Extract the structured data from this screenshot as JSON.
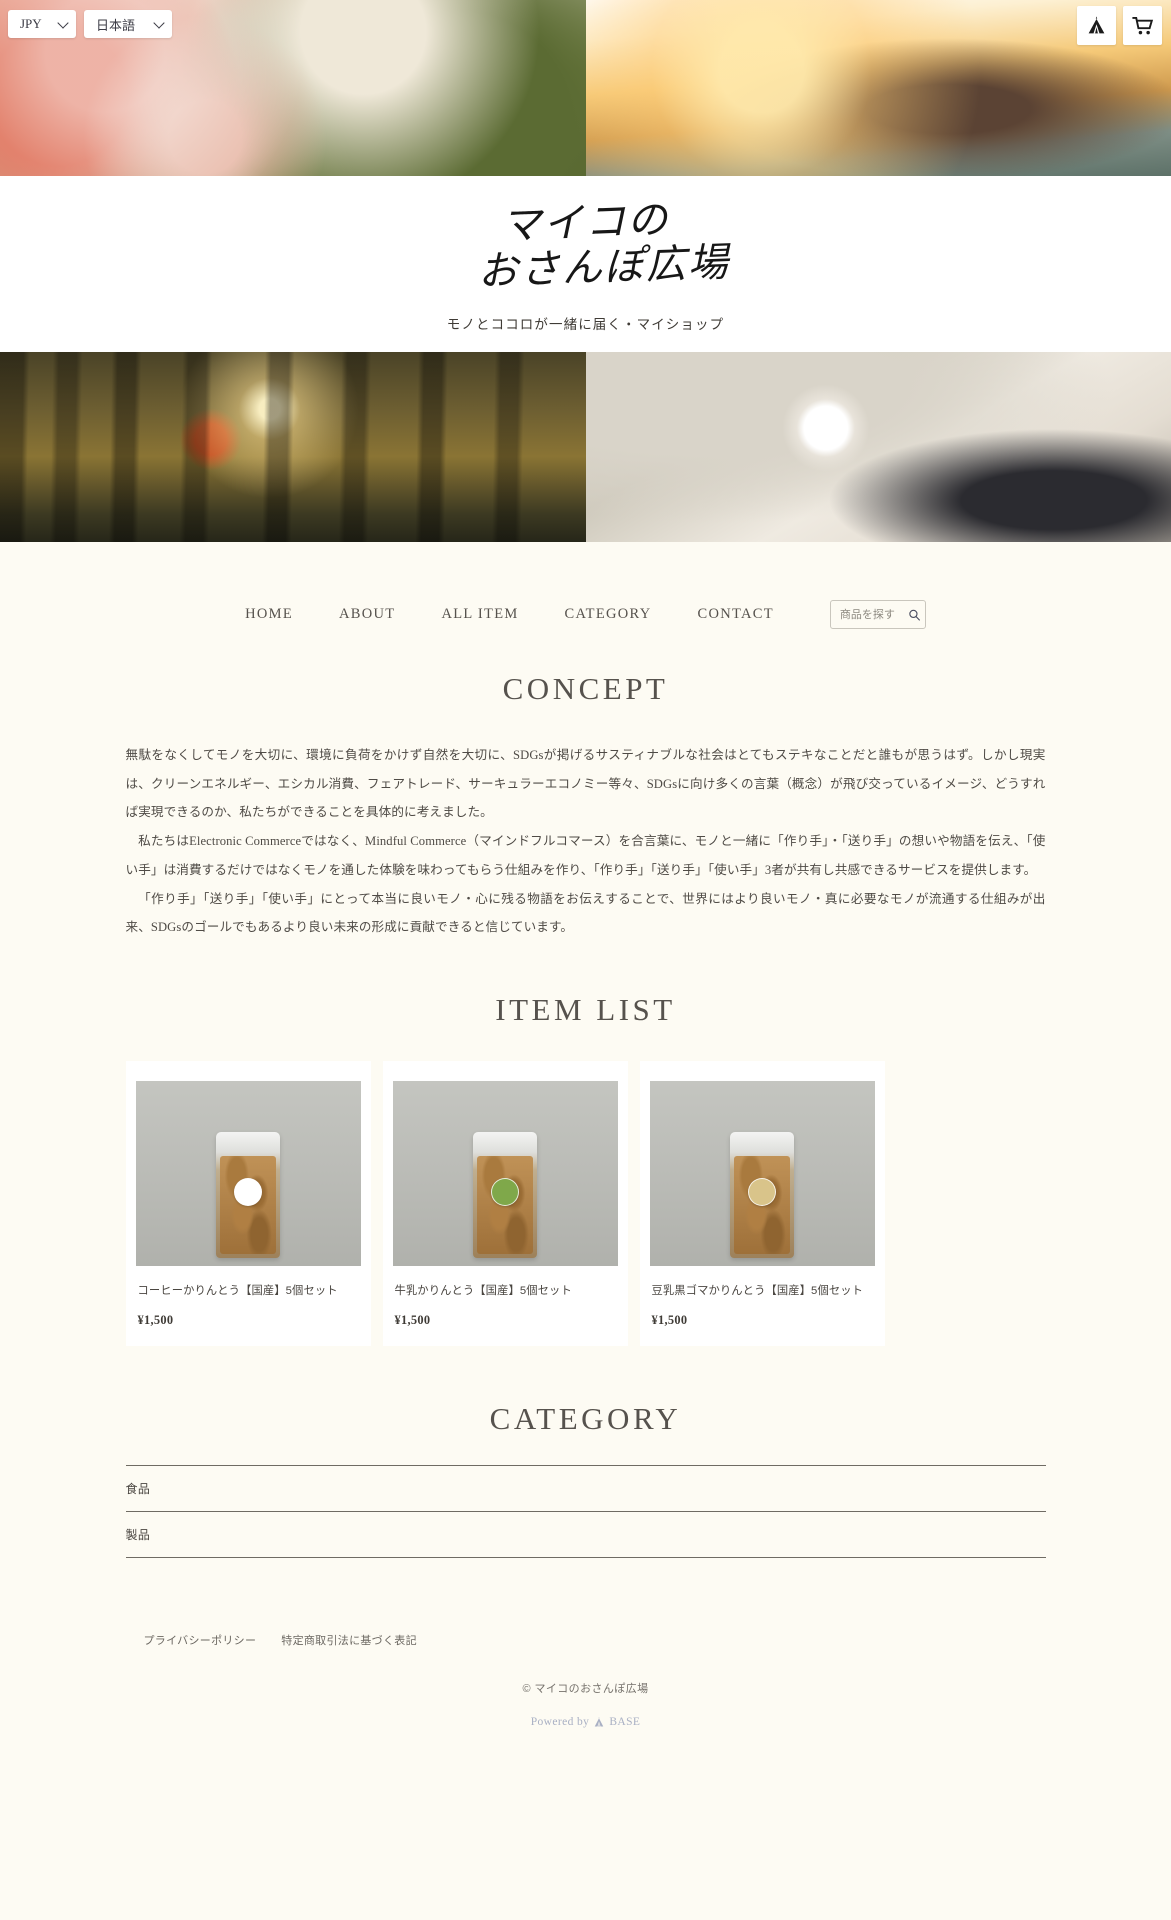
{
  "topbar": {
    "currency": {
      "value": "JPY",
      "icon": "chevron-down-icon"
    },
    "language": {
      "value": "日本語",
      "icon": "chevron-down-icon"
    },
    "shop_icon": "base-tent-icon",
    "cart_icon": "shopping-cart-icon"
  },
  "header": {
    "logo_line_1": "マイコの",
    "logo_line_2": "おさんぽ広場",
    "tagline": "モノとココロが一緒に届く・マイショップ"
  },
  "nav": {
    "items": [
      {
        "label": "HOME"
      },
      {
        "label": "ABOUT"
      },
      {
        "label": "ALL ITEM"
      },
      {
        "label": "CATEGORY"
      },
      {
        "label": "CONTACT"
      }
    ],
    "search": {
      "placeholder": "商品を探す",
      "value": "",
      "icon": "search-icon"
    }
  },
  "concept": {
    "title": "CONCEPT",
    "paragraphs": [
      "無駄をなくしてモノを大切に、環境に負荷をかけず自然を大切に、SDGsが掲げるサスティナブルな社会はとてもステキなことだと誰もが思うはず。しかし現実は、クリーンエネルギー、エシカル消費、フェアトレード、サーキュラーエコノミー等々、SDGsに向け多くの言葉（概念）が飛び交っているイメージ、どうすれば実現できるのか、私たちができることを具体的に考えました。",
      "私たちはElectronic Commerceではなく、Mindful Commerce（マインドフルコマース）を合言葉に、モノと一緒に「作り手」・「送り手」の想いや物語を伝え、「使い手」は消費するだけではなくモノを通した体験を味わってもらう仕組みを作り、「作り手」「送り手」「使い手」3者が共有し共感できるサービスを提供します。",
      "「作り手」「送り手」「使い手」にとって本当に良いモノ・心に残る物語をお伝えすることで、世界にはより良いモノ・真に必要なモノが流通する仕組みが出来、SDGsのゴールでもあるより良い未来の形成に貢献できると信じています。"
    ]
  },
  "item_list": {
    "title": "ITEM LIST",
    "items": [
      {
        "name": "コーヒーかりんとう【国産】5個セット",
        "price": "¥1,500",
        "label_color": "#ffffff"
      },
      {
        "name": "牛乳かりんとう【国産】5個セット",
        "price": "¥1,500",
        "label_color": "#7fa84a"
      },
      {
        "name": "豆乳黒ゴマかりんとう【国産】5個セット",
        "price": "¥1,500",
        "label_color": "#d9c48a"
      }
    ]
  },
  "category": {
    "title": "CATEGORY",
    "items": [
      {
        "label": "食品"
      },
      {
        "label": "製品"
      }
    ]
  },
  "footer": {
    "links": [
      {
        "label": "プライバシーポリシー"
      },
      {
        "label": "特定商取引法に基づく表記"
      }
    ],
    "copyright": "© マイコのおさんぽ広場",
    "powered_prefix": "Powered by",
    "powered_brand": "BASE",
    "powered_icon": "base-tent-icon"
  },
  "colors": {
    "page_bg": "#fdfbf3",
    "text": "#55514c",
    "rule": "#6f6b63",
    "base_blue": "#a9b0c4"
  }
}
